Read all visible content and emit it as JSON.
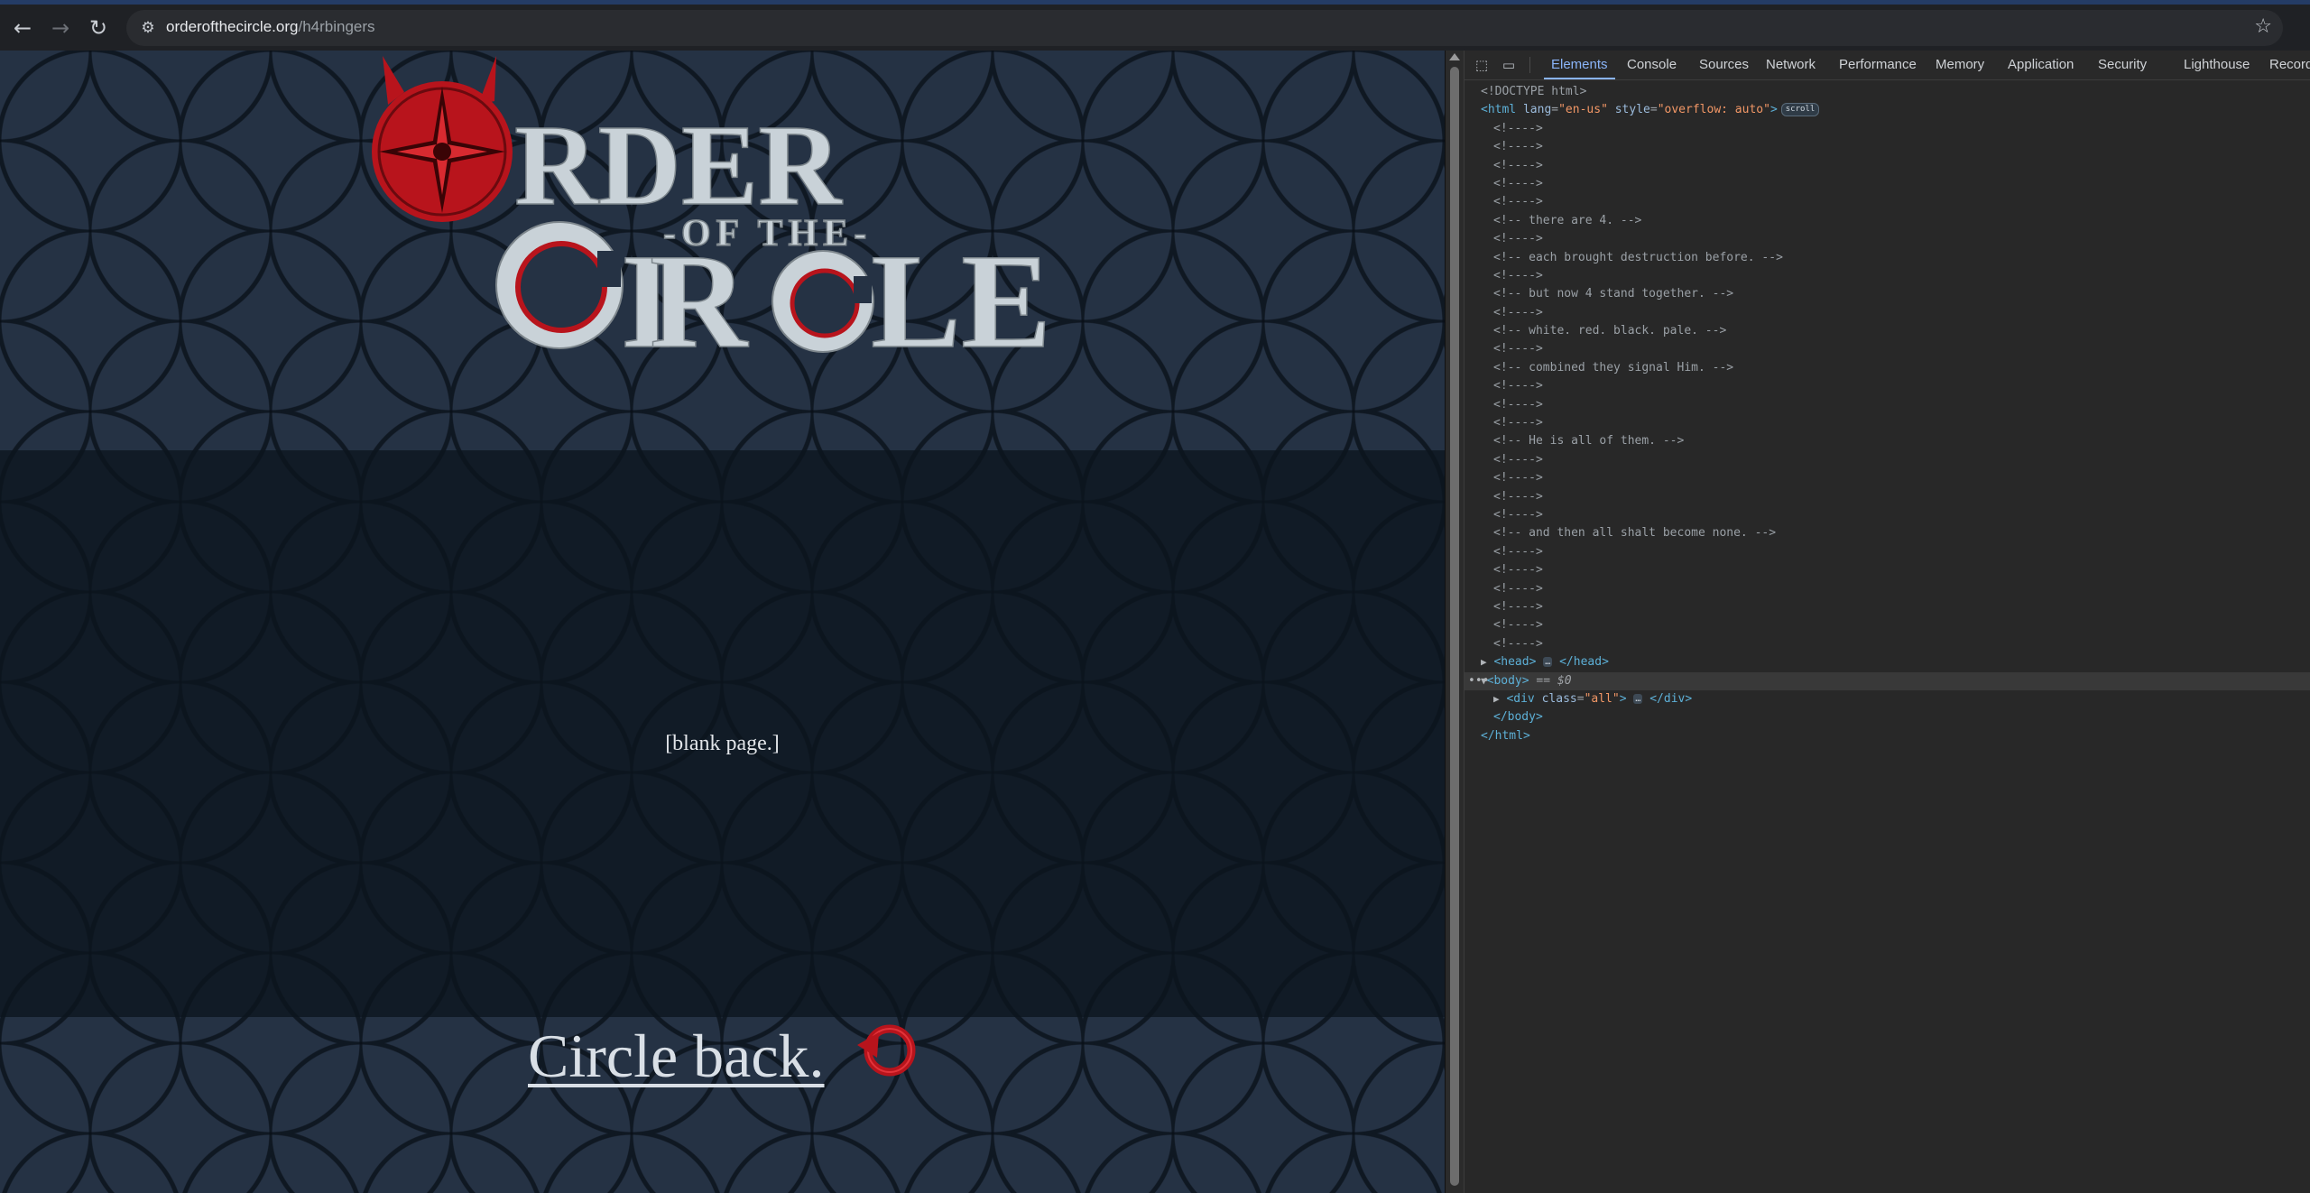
{
  "browser": {
    "url_host": "orderofthecircle.org",
    "url_path": "/h4rbingers",
    "back_icon": "arrow-left-icon",
    "forward_icon": "arrow-right-icon",
    "reload_icon": "reload-icon",
    "bookmark_icon": "star-icon"
  },
  "page": {
    "logo": {
      "line1": "RDER",
      "line2": "-OF THE-",
      "line3_c": "C",
      "line3_i": "I",
      "line3_r": "R",
      "line3_c2": "C",
      "line3_le": "LE"
    },
    "blank_text": "[blank page.]",
    "circle_back_label": "Circle back.",
    "accent_red": "#b8141c",
    "logo_silver": "#c9d2d8"
  },
  "devtools": {
    "tabs": [
      "Elements",
      "Console",
      "Sources",
      "Network",
      "Performance",
      "Memory",
      "Application",
      "Security",
      "Lighthouse",
      "Recorder"
    ],
    "active_tab": "Elements",
    "doctype": "<!DOCTYPE html>",
    "html_tag_open": "<html",
    "html_lang_attr": "lang",
    "html_lang_val": "\"en-us\"",
    "html_style_attr": "style",
    "html_style_val": "\"overflow: auto\"",
    "html_close_bracket": ">",
    "scroll_badge": "scroll",
    "comments": [
      "<!---->",
      "<!---->",
      "<!---->",
      "<!---->",
      "<!---->",
      "<!-- there are 4. -->",
      "<!---->",
      "<!-- each brought destruction before. -->",
      "<!---->",
      "<!-- but now 4 stand together. -->",
      "<!---->",
      "<!-- white. red. black. pale. -->",
      "<!---->",
      "<!-- combined they signal Him. -->",
      "<!---->",
      "<!---->",
      "<!---->",
      "<!-- He is all of them. -->",
      "<!---->",
      "<!---->",
      "<!---->",
      "<!---->",
      "<!-- and then all shalt become none. -->",
      "<!---->",
      "<!---->",
      "<!---->",
      "<!---->",
      "<!---->",
      "<!---->"
    ],
    "head_open": "<head>",
    "head_close": "</head>",
    "body_open": "<body>",
    "body_selected_marker": " == $0",
    "div_open": "<div",
    "div_class_attr": "class",
    "div_class_val": "\"all\"",
    "div_close": "</div>",
    "body_close": "</body>",
    "html_close": "</html>",
    "ellipsis": "…",
    "dots_marker": "•••"
  }
}
